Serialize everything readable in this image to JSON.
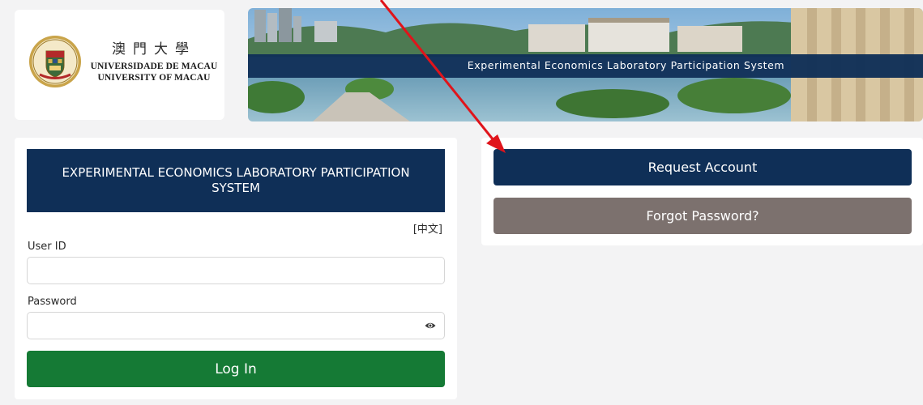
{
  "logo": {
    "chinese_name": "澳門大學",
    "portuguese_name": "UNIVERSIDADE DE MACAU",
    "english_name": "UNIVERSITY OF MACAU",
    "seal_text": "UNIVERSIDADE DE MACAU"
  },
  "banner": {
    "title": "Experimental Economics Laboratory Participation System"
  },
  "login": {
    "header": "EXPERIMENTAL ECONOMICS LABORATORY PARTICIPATION SYSTEM",
    "language_link": "[中文]",
    "user_id_label": "User ID",
    "user_id_value": "",
    "password_label": "Password",
    "password_value": "",
    "password_toggle_icon": "eye-icon",
    "login_button": "Log In"
  },
  "actions": {
    "request_account": "Request Account",
    "forgot_password": "Forgot Password?"
  },
  "colors": {
    "navy": "#0f2f57",
    "green": "#157a35",
    "taupe": "#7c716e",
    "annotation_red": "#e0141b"
  }
}
